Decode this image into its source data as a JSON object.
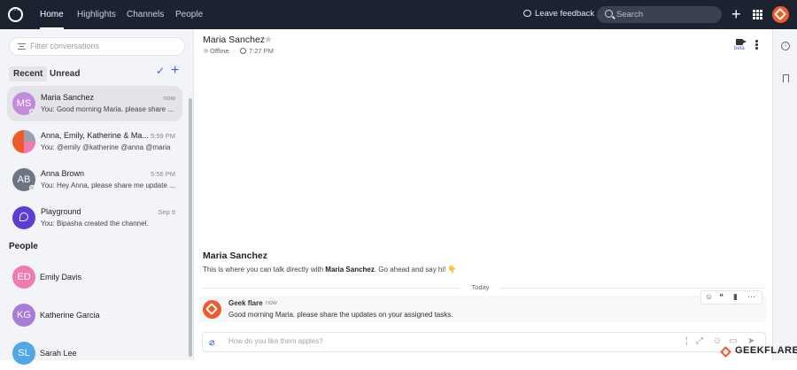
{
  "topbar": {
    "nav": [
      "Home",
      "Highlights",
      "Channels",
      "People"
    ],
    "feedback_label": "Leave feedback",
    "search_placeholder": "Search"
  },
  "sidebar": {
    "filter_placeholder": "Filter conversations",
    "tabs": [
      "Recent",
      "Unread"
    ],
    "conversations": [
      {
        "initials": "MS",
        "name": "Maria Sanchez",
        "time": "now",
        "preview": "You: Good morning Maria. please share ...",
        "color": "#c48bdc"
      },
      {
        "initials": "",
        "name": "Anna, Emily, Katherine & Ma...",
        "time": "5:59 PM",
        "preview": "You: @emily @katherine @anna @maria",
        "color": "#ef5a2a"
      },
      {
        "initials": "AB",
        "name": "Anna Brown",
        "time": "5:56 PM",
        "preview": "You: Hey Anna, please share me update ...",
        "color": "#6e7485"
      },
      {
        "initials": "",
        "name": "Playground",
        "time": "Sep 9",
        "preview": "You: Bipasha created the channel.",
        "color": "#5b3fd4"
      }
    ],
    "people_title": "People",
    "people": [
      {
        "initials": "ED",
        "name": "Emily Davis",
        "color": "#f07ab2"
      },
      {
        "initials": "KG",
        "name": "Katherine Garcia",
        "color": "#a77bd6"
      },
      {
        "initials": "SL",
        "name": "Sarah Lee",
        "color": "#4fa7e6"
      }
    ]
  },
  "chat": {
    "title": "Maria Sanchez",
    "status": "Offline",
    "separator": "·",
    "local_time": "7:27 PM",
    "video_beta": "beta",
    "intro_name": "Maria Sanchez",
    "intro_prefix": "This is where you can talk directly with ",
    "intro_bold": "Maria Sanchez",
    "intro_suffix": ". Go ahead and say hi! 👇",
    "date_divider": "Today",
    "message": {
      "author": "Geek flare",
      "time": "now",
      "text": "Good morning Maria. please share the updates on your assigned tasks."
    },
    "composer_placeholder": "How do you like them apples?"
  },
  "watermark": "GEEKFLARE",
  "colors": {
    "topbar": "#1c2230",
    "accent": "#3b5fd9",
    "brand": "#ef5a2a"
  }
}
